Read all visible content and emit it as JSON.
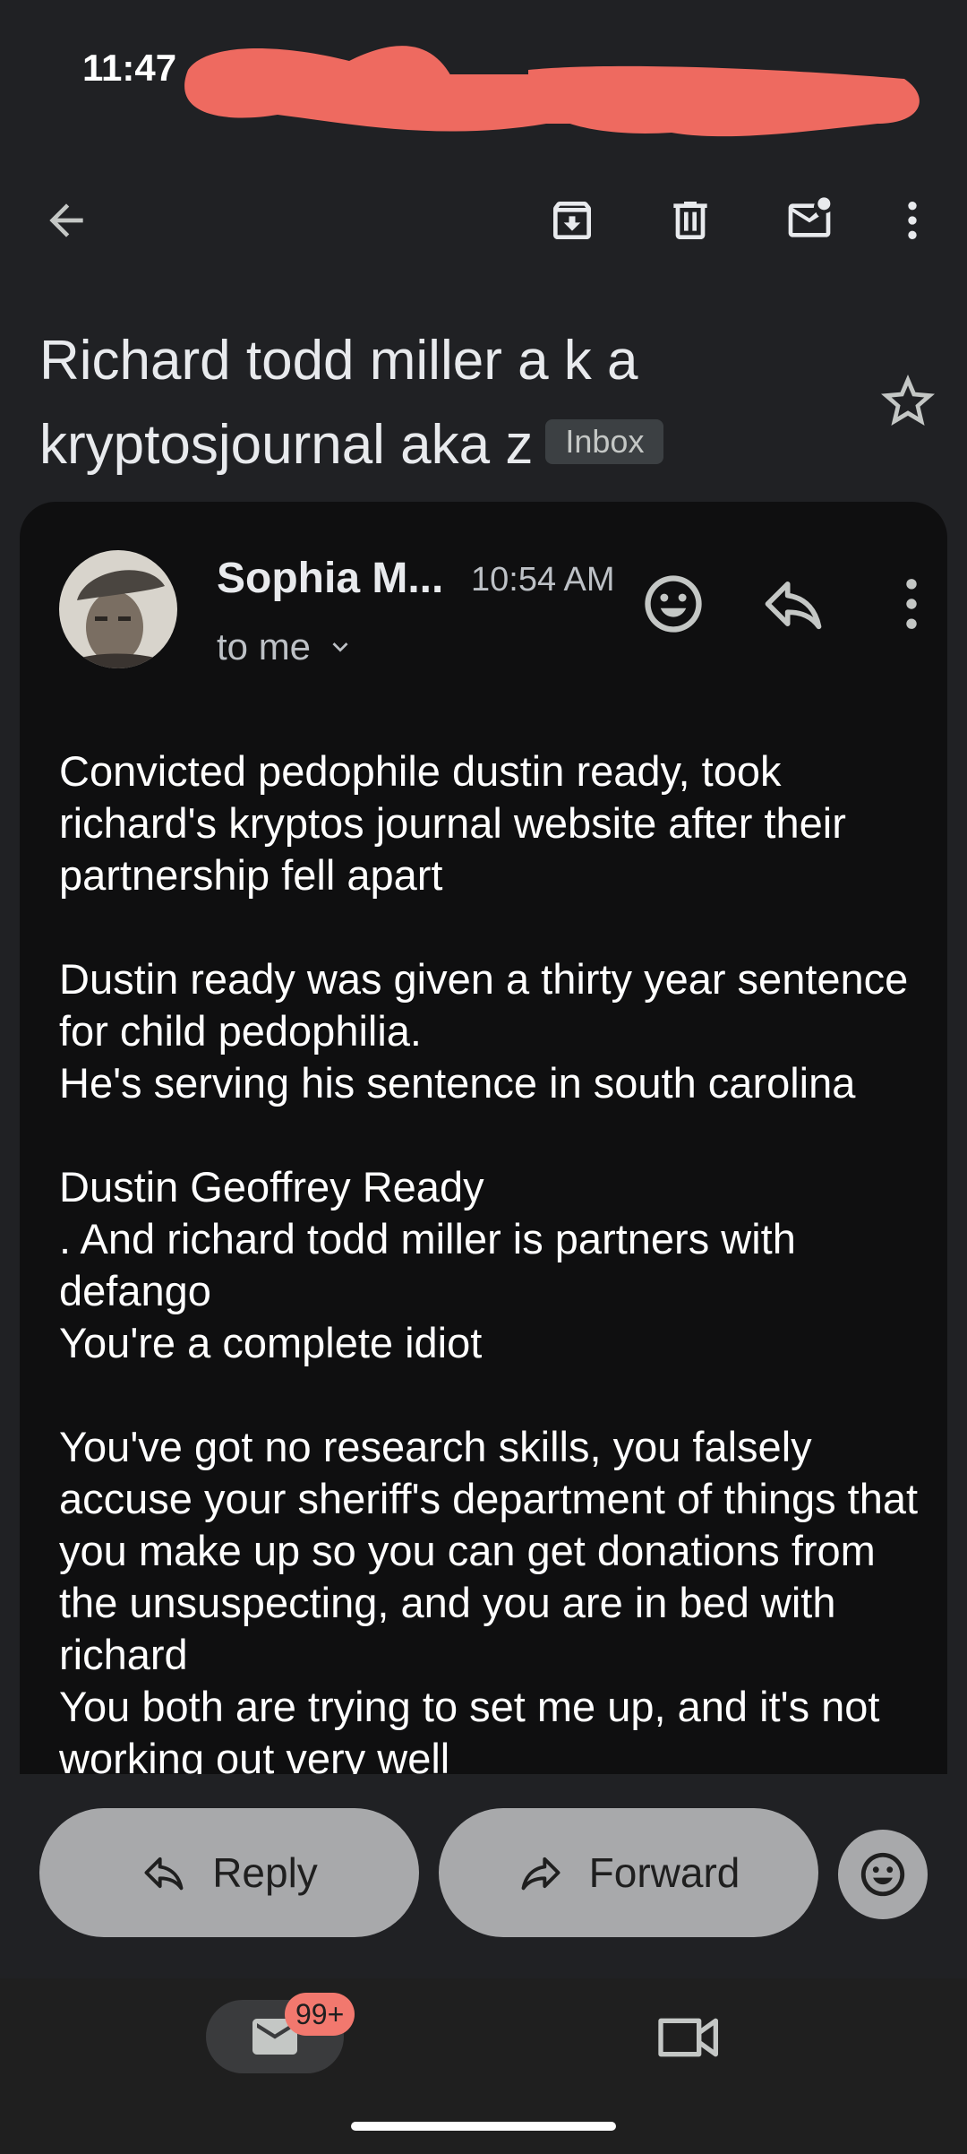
{
  "status_bar": {
    "time": "11:47"
  },
  "toolbar": {
    "back_icon": "arrow-left-icon",
    "archive_icon": "archive-icon",
    "delete_icon": "trash-icon",
    "mark_unread_icon": "mark-unread-icon",
    "more_icon": "more-vert-icon"
  },
  "email": {
    "subject": "Richard todd miller a k a kryptosjournal aka z",
    "label": "Inbox",
    "sender": "Sophia M...",
    "time": "10:54 AM",
    "recipient": "to me",
    "body": "Convicted pedophile dustin ready, took richard's kryptos journal website after their partnership fell apart\n\nDustin ready was given a thirty year sentence for child pedophilia.\nHe's serving his sentence in south carolina\n\nDustin Geoffrey Ready\n. And richard todd miller is partners with defango\nYou're a complete idiot\n\nYou've got no research skills, you falsely accuse your sheriff's department of things that you make up so you can get donations from the unsuspecting, and you are in bed with richard\nYou both are trying to set me up, and it's not working out very well"
  },
  "actions": {
    "reply": "Reply",
    "forward": "Forward"
  },
  "bottom_nav": {
    "mail_badge": "99+"
  },
  "colors": {
    "background": "#202124",
    "card": "#0f0f10",
    "pill": "#a8a9ab",
    "badge": "#f2786e",
    "redaction": "#ee6a60"
  }
}
